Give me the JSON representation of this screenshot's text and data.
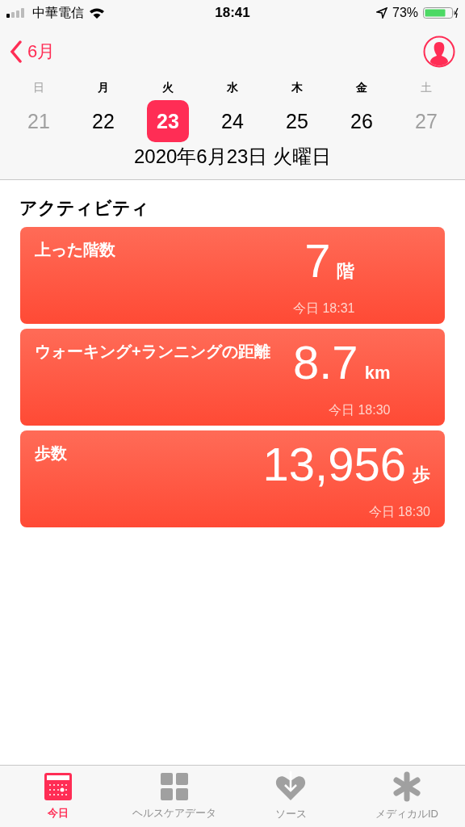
{
  "status_bar": {
    "carrier": "中華電信",
    "time": "18:41",
    "battery": "73%"
  },
  "nav": {
    "back": "6月"
  },
  "week": [
    {
      "weekday": "日",
      "day": "21",
      "weekend": true,
      "selected": false
    },
    {
      "weekday": "月",
      "day": "22",
      "weekend": false,
      "selected": false
    },
    {
      "weekday": "火",
      "day": "23",
      "weekend": false,
      "selected": true
    },
    {
      "weekday": "水",
      "day": "24",
      "weekend": false,
      "selected": false
    },
    {
      "weekday": "木",
      "day": "25",
      "weekend": false,
      "selected": false
    },
    {
      "weekday": "金",
      "day": "26",
      "weekend": false,
      "selected": false
    },
    {
      "weekday": "土",
      "day": "27",
      "weekend": true,
      "selected": false
    }
  ],
  "date_title": "2020年6月23日 火曜日",
  "section_title": "アクティビティ",
  "cards": [
    {
      "title": "上った階数",
      "value": "7",
      "unit": "階",
      "time": "今日 18:31"
    },
    {
      "title": "ウォーキング+ランニングの距離",
      "value": "8.7",
      "unit": "km",
      "time": "今日 18:30"
    },
    {
      "title": "歩数",
      "value": "13,956",
      "unit": "歩",
      "time": "今日 18:30"
    }
  ],
  "tab_bar": [
    {
      "kind": "today",
      "label": "今日",
      "selected": true
    },
    {
      "kind": "data",
      "label": "ヘルスケアデータ",
      "selected": false
    },
    {
      "kind": "sources",
      "label": "ソース",
      "selected": false
    },
    {
      "kind": "medical",
      "label": "メディカルID",
      "selected": false
    }
  ]
}
